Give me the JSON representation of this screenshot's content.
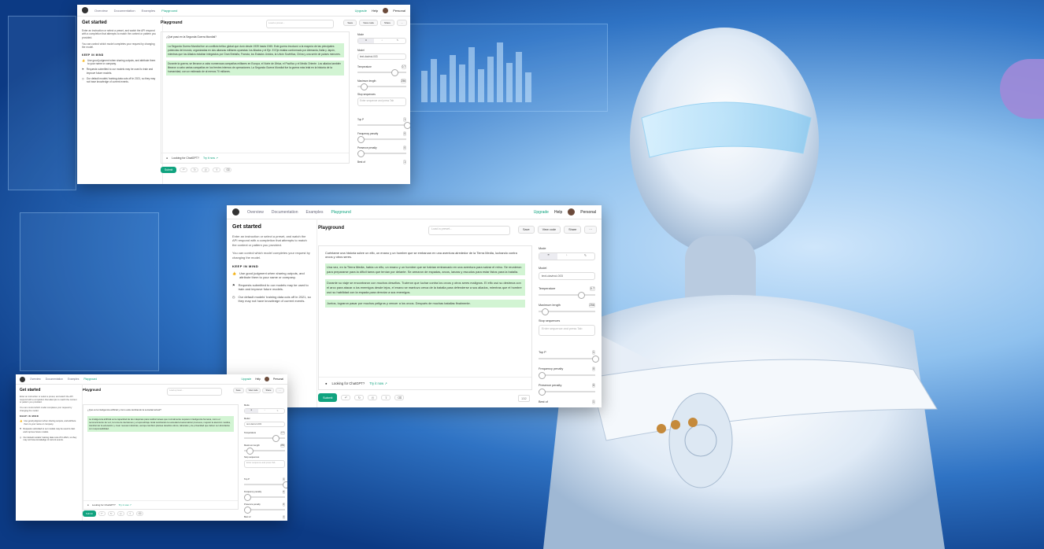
{
  "colors": {
    "accent": "#10a37f",
    "highlight": "#d2f4d3",
    "background": "#1a5bb6"
  },
  "nav": {
    "overview": "Overview",
    "documentation": "Documentation",
    "examples": "Examples",
    "playground": "Playground",
    "upgrade": "Upgrade",
    "help": "Help",
    "personal": "Personal"
  },
  "sidebar": {
    "title": "Get started",
    "intro": "Enter an instruction or select a preset, and watch the API respond with a completion that attempts to match the context or pattern you provided.",
    "intro_link": "completion",
    "intro2": "You can control which model completes your request by changing the model.",
    "intro2_link": "model",
    "tips_title": "KEEP IN MIND",
    "tips": [
      {
        "icon": "thumbs-up",
        "text": "Use good judgment when sharing outputs, and attribute them to your name or company.",
        "link": "Learn more."
      },
      {
        "icon": "flag",
        "text": "Requests submitted to our models may be used to train and improve future models.",
        "link": "Learn more."
      },
      {
        "icon": "clock",
        "text": "Our default models' training data cuts off in 2021, so they may not have knowledge of current events."
      }
    ]
  },
  "playground": {
    "title": "Playground",
    "preset_placeholder": "Load a preset...",
    "save": "Save",
    "view_code": "View code",
    "share": "Share",
    "more": "···"
  },
  "windows": [
    {
      "question": "¿Qué pasó en la Segunda Guerra Mundial?",
      "answers": [
        "La Segunda Guerra Mundial fue un conflicto bélico global que duró desde 1939 hasta 1945. Este guerra involucró a la mayoría de las principales potencias del mundo, organizadas en dos alianzas militares opuestas: los Aliados y el Eje. El Eje estaba conformado por Alemania, Italia y Japón, mientras que los Aliados estaban integrados por Gran Bretaña, Francia, los Estados Unidos, la Unión Soviética, China y una serie de países menores.",
        "Durante la guerra, se llevaron a cabo numerosas campañas militares en Europa, el Norte de África, el Pacífico y el Medio Oriente. Los aliados también libraron a cabo varias campañas en los frentes internos de operaciones. La Segunda Guerra Mundial fue la guerra más letal en la historia de la humanidad, con un estimado de al menos 70 millones."
      ]
    },
    {
      "question": "Cuéntame una historia sobre un elfo, un enano y un hombre que se embarcan en una aventura alrededor de la Tierra Media, luchando contra orcos y otros seres.",
      "answers": [
        "Una vez, en la Tierra Media, había un elfo, un enano y un hombre que se habían embarcado en una aventura para salvar el reino. Se reunieron para prepararse para la difícil tarea que tenían por delante. Se armaron de espadas, arcos, lanzas y escudos para estar listos para la batalla.",
        "Durante su viaje se encontraron con muchos desafíos. Tuvieron que luchar contra los orcos y otros seres malignos. El elfo usó su destreza con el arco para atacar a los enemigos desde lejos, el enano se mantuvo cerca de la batalla para defenderse a sus aliados, mientras que el hombre usó su habilidad con la espada para derrotar a sus enemigos.",
        "Juntos, lograron pasar por muchos peligros y vencer a los orcos. Después de muchas batallas finalmente."
      ]
    },
    {
      "question": "¿Qué es la inteligencia artificial y cómo está cambiando la sociedad actual?",
      "answers": [
        "La inteligencia artificial es la capacidad de las máquinas para realizar tareas que normalmente requieren inteligencia humana, como el reconocimiento de voz, la toma de decisiones y el aprendizaje. Está cambiando la sociedad al automatizar procesos, mejorar la atención médica, transformar la educación y crear nuevas industrias, aunque también plantea desafíos éticos, laborales y de privacidad que deben ser abordados con responsabilidad."
      ]
    }
  ],
  "chatgpt": {
    "label": "Looking for ChatGPT?",
    "try": "Try it now ↗"
  },
  "submit": "Submit",
  "settings": {
    "mode": "Mode",
    "model": "Model",
    "model_value": "text-davinci-003",
    "temperature": "Temperature",
    "temperature_value": "0.7",
    "max_length": "Maximum length",
    "max_length_value": "256",
    "stop": "Stop sequences",
    "stop_placeholder": "Enter sequence and press Tab",
    "top_p": "Top P",
    "top_p_value": "1",
    "freq": "Frequency penalty",
    "freq_value": "0",
    "pres": "Presence penalty",
    "pres_value": "0",
    "best": "Best of",
    "best_value": "1"
  },
  "counter": "132"
}
